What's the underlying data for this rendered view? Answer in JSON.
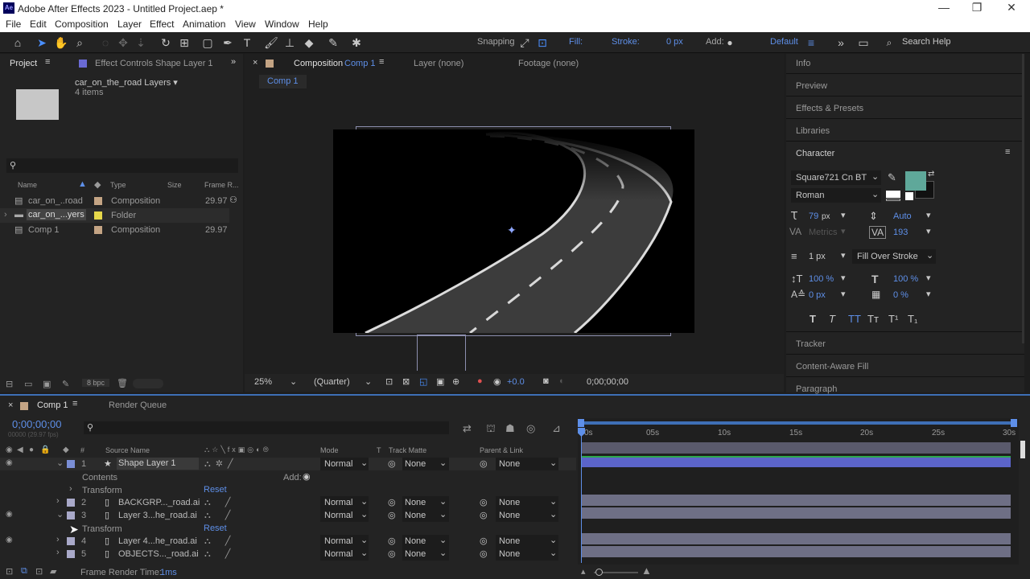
{
  "window": {
    "title": "Adobe After Effects 2023 - Untitled Project.aep *",
    "logo": "Ae",
    "minimize": "—",
    "maximize": "❐",
    "close": "✕"
  },
  "menu": [
    "File",
    "Edit",
    "Composition",
    "Layer",
    "Effect",
    "Animation",
    "View",
    "Window",
    "Help"
  ],
  "toolbar": {
    "snapping": "Snapping",
    "fill": "Fill:",
    "stroke": "Stroke:",
    "stroke_px": "0 px",
    "add": "Add:",
    "workspace": "Default",
    "search": "Search Help"
  },
  "project": {
    "tab": "Project",
    "effect_tab": "Effect Controls Shape Layer 1",
    "folder_name": "car_on_the_road Layers ▾",
    "folder_count": "4 items",
    "cols": [
      "Name",
      "Type",
      "Size",
      "Frame R..."
    ],
    "items": [
      {
        "name": "car_on_..road",
        "type": "Composition",
        "fps": "29.97",
        "color": "#c4a484"
      },
      {
        "name": "car_on_...yers",
        "type": "Folder",
        "fps": "",
        "color": "#e6d84a"
      },
      {
        "name": "Comp 1",
        "type": "Composition",
        "fps": "29.97",
        "color": "#c4a484"
      }
    ],
    "bpc": "8 bpc"
  },
  "comp": {
    "tab_label": "Composition",
    "tab_name": "Comp 1",
    "layer_tab": "Layer (none)",
    "footage_tab": "Footage (none)",
    "crumb": "Comp 1",
    "zoom": "25%",
    "quality": "(Quarter)",
    "exposure": "+0.0",
    "time": "0;00;00;00"
  },
  "right": {
    "info": "Info",
    "preview": "Preview",
    "effects": "Effects & Presets",
    "libraries": "Libraries",
    "character": "Character",
    "font": "Square721 Cn BT",
    "style": "Roman",
    "size": "79",
    "size_unit": "px",
    "leading": "Auto",
    "kerning": "Metrics",
    "tracking": "193",
    "stroke_w": "1 px",
    "stroke_type": "Fill Over Stroke",
    "vscale": "100 %",
    "hscale": "100 %",
    "baseline": "0 px",
    "tsume": "0 %",
    "tracker": "Tracker",
    "caf": "Content-Aware Fill",
    "paragraph": "Paragraph",
    "fill_color": "#5fa89a"
  },
  "timeline": {
    "tab": "Comp 1",
    "render_queue": "Render Queue",
    "timecode": "0;00;00;00",
    "fps_note": "00000 (29.97 fps)",
    "col_source": "Source Name",
    "col_mode": "Mode",
    "col_t": "T",
    "col_matte": "Track Matte",
    "col_parent": "Parent & Link",
    "ruler": [
      "0s",
      "05s",
      "10s",
      "15s",
      "20s",
      "25s",
      "30s"
    ],
    "layers": [
      {
        "num": "1",
        "name": "Shape Layer 1",
        "mode": "Normal",
        "matte": "None",
        "parent": "None",
        "color": "#7b8fd6"
      },
      {
        "num": "2",
        "name": "BACKGRP..._road.ai",
        "mode": "Normal",
        "matte": "None",
        "parent": "None",
        "color": "#a9a9c9"
      },
      {
        "num": "3",
        "name": "Layer 3...he_road.ai",
        "mode": "Normal",
        "matte": "None",
        "parent": "None",
        "color": "#a9a9c9"
      },
      {
        "num": "4",
        "name": "Layer 4...he_road.ai",
        "mode": "Normal",
        "matte": "None",
        "parent": "None",
        "color": "#a9a9c9"
      },
      {
        "num": "5",
        "name": "OBJECTS..._road.ai",
        "mode": "Normal",
        "matte": "None",
        "parent": "None",
        "color": "#a9a9c9"
      }
    ],
    "contents": "Contents",
    "add": "Add:",
    "transform": "Transform",
    "reset": "Reset",
    "frame_render": "Frame Render Time:",
    "frame_render_val": "1ms"
  }
}
